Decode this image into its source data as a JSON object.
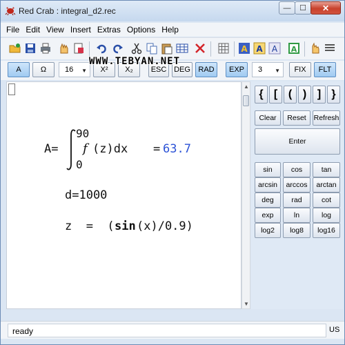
{
  "window": {
    "title": "Red Crab : integral_d2.rec",
    "min_glyph": "—",
    "max_glyph": "☐",
    "close_glyph": "✕"
  },
  "menu": [
    "File",
    "Edit",
    "View",
    "Insert",
    "Extras",
    "Options",
    "Help"
  ],
  "watermark": "WWW.TEBYAN.NET",
  "toolbar2": {
    "a_label": "A",
    "omega_label": "Ω",
    "font_size": "16",
    "superscript_label": "X²",
    "subscript_label": "X₂",
    "esc_label": "ESC",
    "deg_label": "DEG",
    "rad_label": "RAD",
    "exp_label": "EXP",
    "precision": "3",
    "fix_label": "FIX",
    "flt_label": "FLT"
  },
  "editor": {
    "integral_label": "A=",
    "upper_limit": "90",
    "lower_limit": "0",
    "integrand": "f",
    "integrand_rest": "(z)dx",
    "equals": "=",
    "result": "63.7",
    "d_line": "d=1000",
    "z_line_start": "z  =  (",
    "z_func": "sin",
    "z_line_end": "(x)/0.9)"
  },
  "panel": {
    "brackets": [
      "{",
      "[",
      "(",
      ")",
      "]",
      "}"
    ],
    "clear_label": "Clear",
    "reset_label": "Reset",
    "refresh_label": "Refresh",
    "enter_label": "Enter",
    "functions": [
      [
        "sin",
        "cos",
        "tan"
      ],
      [
        "arcsin",
        "arccos",
        "arctan"
      ],
      [
        "deg",
        "rad",
        "cot"
      ],
      [
        "exp",
        "ln",
        "log"
      ],
      [
        "log2",
        "log8",
        "log16"
      ]
    ]
  },
  "status": {
    "text": "ready",
    "lang": "US"
  },
  "colors": {
    "result_blue": "#2b52d6",
    "accent_blue": "#9fcaf1"
  }
}
